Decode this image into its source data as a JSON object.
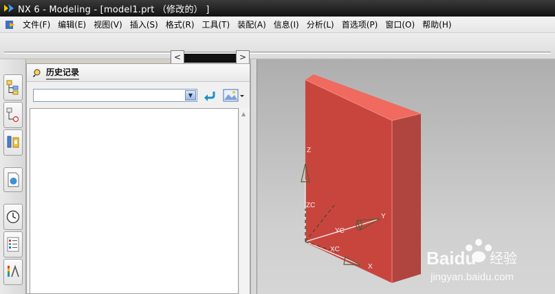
{
  "titlebar": {
    "title": "NX 6 - Modeling - [model1.prt （修改的） ]"
  },
  "menubar": {
    "items": [
      "文件(F)",
      "编辑(E)",
      "视图(V)",
      "插入(S)",
      "格式(R)",
      "工具(T)",
      "装配(A)",
      "信息(I)",
      "分析(L)",
      "首选项(P)",
      "窗口(O)",
      "帮助(H)"
    ]
  },
  "toolbar": {
    "scroll_left_glyph": "<",
    "scroll_right_glyph": ">"
  },
  "navigator": {
    "title": "历史记录",
    "filter_value": "",
    "dropdown_glyph": "▼",
    "scroll_up_glyph": "▲"
  },
  "viewport": {
    "triad": {
      "z_label": "Z",
      "zc_label": "ZC",
      "yc_label": "YC",
      "y_label": "Y",
      "xc_label": "XC",
      "x_label": "X"
    },
    "body_color": "#c8453e",
    "body_top_color": "#f06a5f",
    "body_side_color": "#b0443e"
  },
  "watermark": {
    "brand": "Baidu",
    "brand_cn": "经验",
    "url": "jingyan.baidu.com"
  }
}
